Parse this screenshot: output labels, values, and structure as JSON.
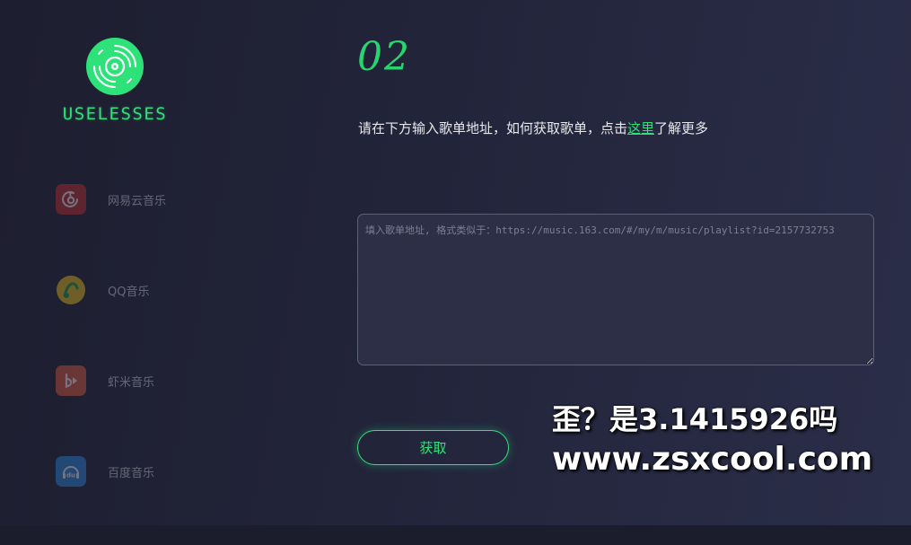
{
  "logo": {
    "text": "USELESSES",
    "icon": "vinyl-disc-icon",
    "color": "#2ee27a"
  },
  "sidebar": {
    "items": [
      {
        "label": "网易云音乐",
        "icon": "netease-music-icon",
        "color": "#c62f2f"
      },
      {
        "label": "QQ音乐",
        "icon": "qq-music-icon",
        "color": "#f6c21c"
      },
      {
        "label": "虾米音乐",
        "icon": "xiami-music-icon",
        "color": "#e55b3c"
      },
      {
        "label": "百度音乐",
        "icon": "baidu-music-icon",
        "color": "#2a8be6"
      }
    ]
  },
  "main": {
    "step": "02",
    "instruction_before": "请在下方输入歌单地址，如何获取歌单，点击",
    "instruction_link": "这里",
    "instruction_after": "了解更多",
    "input": {
      "value": "",
      "placeholder": "填入歌单地址, 格式类似于：https://music.163.com/#/my/m/music/playlist?id=2157732753"
    },
    "fetch_label": "获取"
  },
  "watermark": {
    "line1": "歪？是3.1415926吗",
    "line2": "www.zsxcool.com"
  }
}
